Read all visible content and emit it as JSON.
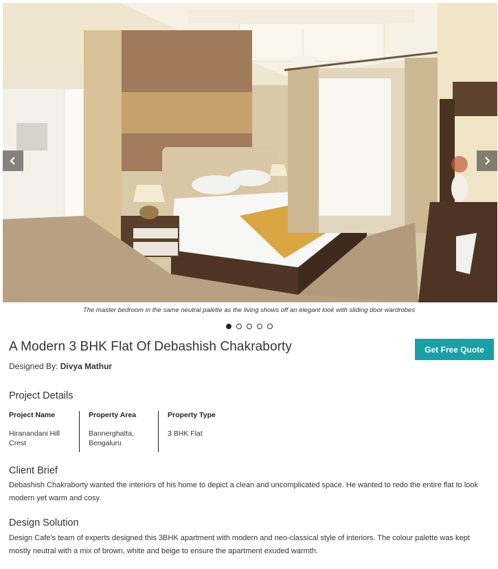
{
  "carousel": {
    "caption": "The master bedroom in the same neutral palette as the living shows off an elegant look with sliding door wardrobes",
    "slide_count": 5,
    "active_slide": 1
  },
  "project": {
    "title": "A Modern 3 BHK Flat Of Debashish Chakraborty",
    "designed_by_label": "Designed By:",
    "designer": "Divya Mathur",
    "quote_button": "Get Free Quote"
  },
  "details": {
    "heading": "Project Details",
    "columns": [
      {
        "label": "Project Name",
        "value": "Hiranandani Hill Crest"
      },
      {
        "label": "Property Area",
        "value": "Bannerghatta, Bengaluru"
      },
      {
        "label": "Property Type",
        "value": "3 BHK Flat"
      }
    ]
  },
  "client_brief": {
    "heading": "Client Brief",
    "text": "Debashish Chakraborty wanted the interiors of his home to depict a clean and uncomplicated space. He wanted to redo the entire flat to look modern yet warm and cosy."
  },
  "design_solution": {
    "heading": "Design Solution",
    "text": "Design Cafe's team of experts designed this 3BHK apartment with modern and neo-classical style of interiors. The colour palette was kept mostly neutral with a mix of brown, white and beige to ensure the apartment exuded warmth."
  },
  "colors": {
    "accent": "#19a0a6",
    "text": "#333333"
  },
  "icons": {
    "prev": "chevron-left-icon",
    "next": "chevron-right-icon"
  }
}
